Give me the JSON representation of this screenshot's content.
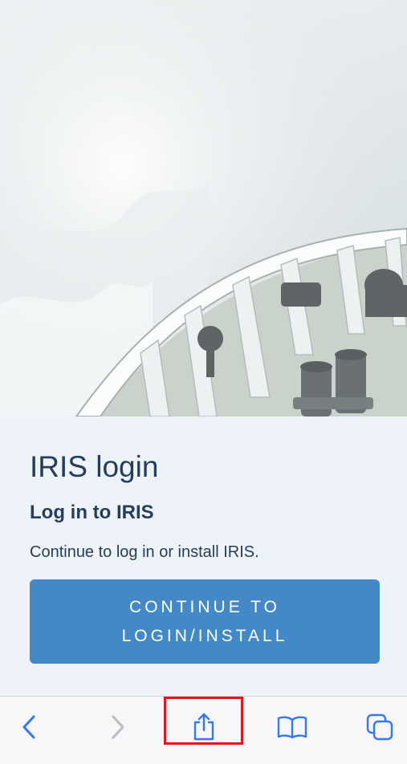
{
  "hero": {
    "image": "ship-bow-in-waves-photo"
  },
  "login": {
    "title": "IRIS login",
    "subtitle": "Log in to IRIS",
    "description": "Continue to log in or install IRIS.",
    "button_label": "CONTINUE TO LOGIN/INSTALL"
  },
  "toolbar": {
    "items": [
      {
        "icon": "chevron-left-icon",
        "enabled": true
      },
      {
        "icon": "chevron-right-icon",
        "enabled": false
      },
      {
        "icon": "share-icon",
        "enabled": true,
        "highlighted": true
      },
      {
        "icon": "book-icon",
        "enabled": true
      },
      {
        "icon": "tabs-icon",
        "enabled": true
      }
    ]
  },
  "colors": {
    "accent": "#4389c8",
    "text": "#243e5c",
    "background": "#eef3f9",
    "highlight": "#e4161d",
    "toolbar_icon": "#3478f6"
  }
}
